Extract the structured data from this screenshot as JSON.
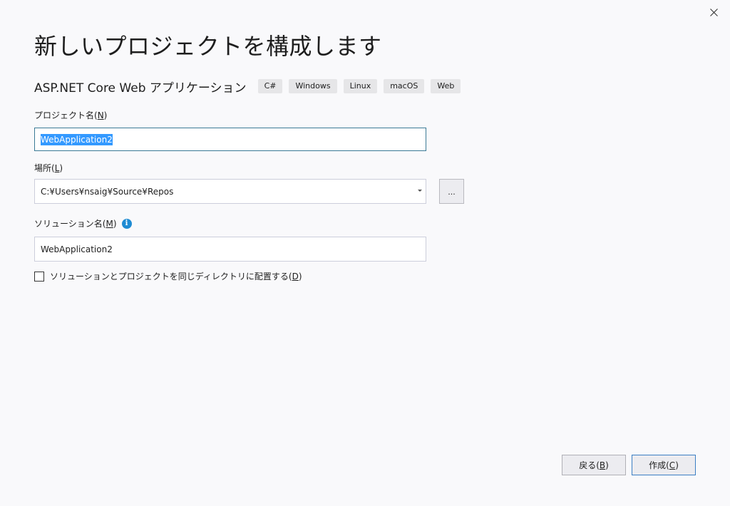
{
  "dialog": {
    "title": "新しいプロジェクトを構成します",
    "close_icon": "close-icon"
  },
  "template": {
    "name": "ASP.NET Core Web アプリケーション",
    "tags": [
      "C#",
      "Windows",
      "Linux",
      "macOS",
      "Web"
    ]
  },
  "project_name": {
    "label": "プロジェクト名(",
    "accel": "N",
    "label_end": ")",
    "value": "WebApplication2"
  },
  "location": {
    "label": "場所(",
    "accel": "L",
    "label_end": ")",
    "value": "C:¥Users¥nsaig¥Source¥Repos",
    "browse_label": "..."
  },
  "solution_name": {
    "label": "ソリューション名(",
    "accel": "M",
    "label_end": ")",
    "info_icon": "info-icon",
    "value": "WebApplication2"
  },
  "same_directory": {
    "label": "ソリューションとプロジェクトを同じディレクトリに配置する(",
    "accel": "D",
    "label_end": ")",
    "checked": false
  },
  "footer": {
    "back_label": "戻る(",
    "back_accel": "B",
    "create_label": "作成(",
    "create_accel": "C",
    "paren_end": ")"
  }
}
